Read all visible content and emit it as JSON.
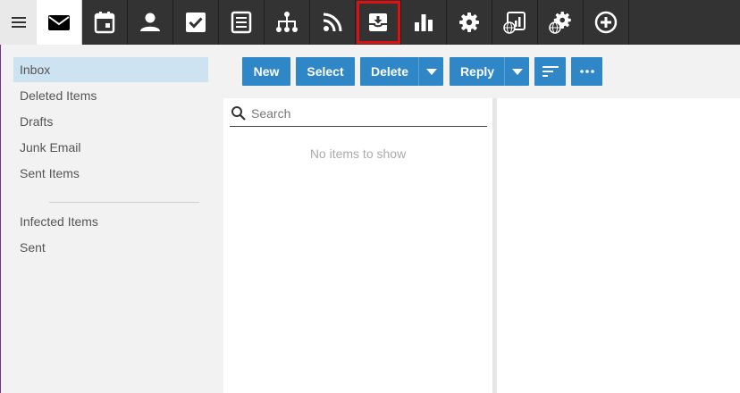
{
  "nav": {
    "menu_icon": "hamburger-icon",
    "tabs": [
      {
        "name": "mail",
        "icon": "envelope-icon",
        "active": true
      },
      {
        "name": "calendar",
        "icon": "calendar-icon"
      },
      {
        "name": "contacts",
        "icon": "person-icon"
      },
      {
        "name": "tasks",
        "icon": "checkbox-icon"
      },
      {
        "name": "notes",
        "icon": "notes-icon"
      },
      {
        "name": "org-chart",
        "icon": "sitemap-icon"
      },
      {
        "name": "rss",
        "icon": "rss-icon"
      },
      {
        "name": "inbox-download",
        "icon": "inbox-download-icon",
        "highlighted": true
      },
      {
        "name": "reports",
        "icon": "bar-chart-icon"
      },
      {
        "name": "settings",
        "icon": "gear-icon"
      },
      {
        "name": "web-reports",
        "icon": "globe-chart-icon"
      },
      {
        "name": "web-settings",
        "icon": "globe-gear-icon"
      },
      {
        "name": "add",
        "icon": "plus-circle-icon"
      }
    ]
  },
  "folders": {
    "primary": [
      "Inbox",
      "Deleted Items",
      "Drafts",
      "Junk Email",
      "Sent Items"
    ],
    "secondary": [
      "Infected Items",
      "Sent"
    ],
    "selected": "Inbox"
  },
  "toolbar": {
    "new_label": "New",
    "select_label": "Select",
    "delete_label": "Delete",
    "reply_label": "Reply",
    "sort_icon": "sort-icon",
    "more_icon": "more-icon"
  },
  "list": {
    "search_placeholder": "Search",
    "empty_message": "No items to show"
  },
  "colors": {
    "accent": "#2f87c8",
    "appbar": "#333333",
    "selected_folder": "#cde3f2",
    "highlight_border": "#e01010"
  }
}
